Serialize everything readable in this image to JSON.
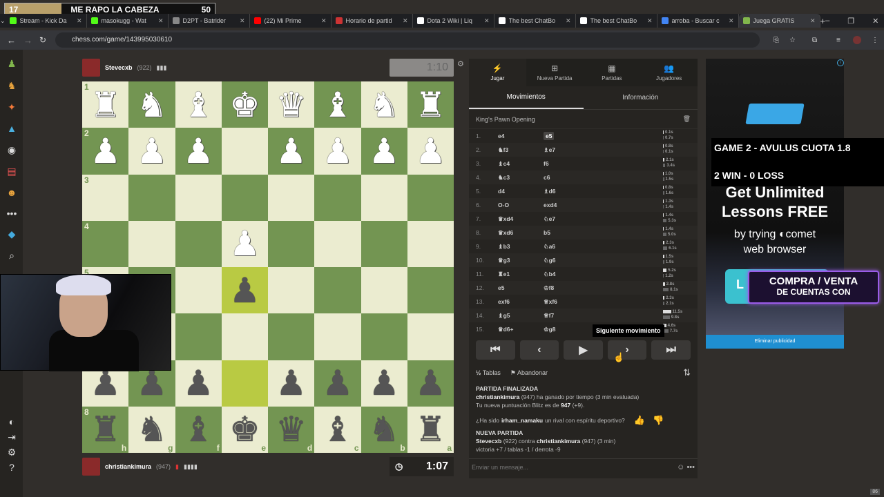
{
  "overlay": {
    "left": "17",
    "title": "ME RAPO LA CABEZA",
    "right": "50",
    "fill": 0.27
  },
  "tabs": [
    {
      "label": "Stream - Kick Da",
      "color": "#53fc18"
    },
    {
      "label": "masokugg - Wat",
      "color": "#53fc18"
    },
    {
      "label": "D2PT - Batrider",
      "color": "#888888"
    },
    {
      "label": "(22) Mi Prime",
      "color": "#ff0000"
    },
    {
      "label": "Horario de partid",
      "color": "#c33"
    },
    {
      "label": "Dota 2 Wiki | Liq",
      "color": "#ffffff"
    },
    {
      "label": "The best ChatBo",
      "color": "#ffffff"
    },
    {
      "label": "The best ChatBo",
      "color": "#ffffff"
    },
    {
      "label": "arroba - Buscar c",
      "color": "#4285f4"
    },
    {
      "label": "Juega GRATIS",
      "color": "#81b64c",
      "active": true
    }
  ],
  "address": {
    "url": "chess.com/game/143995030610"
  },
  "top_player": {
    "name": "Stevecxb",
    "rating": "(922)",
    "clock": "1:10"
  },
  "bottom_player": {
    "name": "christiankimura",
    "rating": "(947)",
    "clock": "1:07"
  },
  "board": {
    "rows": [
      "RNBKQBNR",
      "PPP.PPPP",
      "........",
      "...P....",
      "...p....",
      "........",
      "ppp.pppp",
      "rnbkqbnr"
    ],
    "rank_labels": [
      "1",
      "2",
      "3",
      "4",
      "5",
      "6",
      "7",
      "8"
    ],
    "file_labels": [
      "h",
      "g",
      "f",
      "e",
      "d",
      "c",
      "b",
      "a"
    ],
    "highlights": [
      "4-3",
      "6-3"
    ]
  },
  "panel": {
    "tabs": [
      {
        "label": "Jugar",
        "icon": "⚡"
      },
      {
        "label": "Nueva Partida",
        "icon": "⊞"
      },
      {
        "label": "Partidas",
        "icon": "▦"
      },
      {
        "label": "Jugadores",
        "icon": "👥"
      }
    ],
    "subtabs": [
      "Movimientos",
      "Información"
    ],
    "opening": "King's Pawn Opening",
    "moves": [
      {
        "n": "1.",
        "w": "e4",
        "b": "e5",
        "tw": "0.1s",
        "tb": "0.7s"
      },
      {
        "n": "2.",
        "w": "♞f3",
        "b": "♗e7",
        "tw": "0.8s",
        "tb": "0.1s"
      },
      {
        "n": "3.",
        "w": "♝c4",
        "b": "f6",
        "tw": "2.1s",
        "tb": "3.4s"
      },
      {
        "n": "4.",
        "w": "♞c3",
        "b": "c6",
        "tw": "1.0s",
        "tb": "1.5s"
      },
      {
        "n": "5.",
        "w": "d4",
        "b": "♗d6",
        "tw": "0.8s",
        "tb": "1.6s"
      },
      {
        "n": "6.",
        "w": "O-O",
        "b": "exd4",
        "tw": "1.3s",
        "tb": "1.4s"
      },
      {
        "n": "7.",
        "w": "♛xd4",
        "b": "♘e7",
        "tw": "1.4s",
        "tb": "5.3s"
      },
      {
        "n": "8.",
        "w": "♛xd6",
        "b": "b5",
        "tw": "1.4s",
        "tb": "5.0s"
      },
      {
        "n": "9.",
        "w": "♝b3",
        "b": "♘a6",
        "tw": "2.3s",
        "tb": "6.1s"
      },
      {
        "n": "10.",
        "w": "♛g3",
        "b": "♘g6",
        "tw": "1.5s",
        "tb": "1.9s"
      },
      {
        "n": "11.",
        "w": "♜e1",
        "b": "♘b4",
        "tw": "5.2s",
        "tb": "1.2s"
      },
      {
        "n": "12.",
        "w": "e5",
        "b": "♔f8",
        "tw": "2.8s",
        "tb": "8.1s"
      },
      {
        "n": "13.",
        "w": "exf6",
        "b": "♕xf6",
        "tw": "2.3s",
        "tb": "2.1s"
      },
      {
        "n": "14.",
        "w": "♝g5",
        "b": "♕f7",
        "tw": "11.5s",
        "tb": "9.8s"
      },
      {
        "n": "15.",
        "w": "♛d6+",
        "b": "♔g8",
        "tw": "4.6s",
        "tb": "7.7s"
      }
    ],
    "tooltip": "Siguiente movimiento",
    "draw_label": "Tablas",
    "draw_icon": "½",
    "resign_label": "Abandonar",
    "chat": {
      "finished_header": "PARTIDA FINALIZADA",
      "winner": "christiankimura",
      "winner_rest": "(947) ha ganado por tiempo (3 min evaluada)",
      "rating_pre": "Tu nueva puntuación Blitz es de",
      "rating_val": "947",
      "rating_delta": "(+9).",
      "sport_pre": "¿Ha sido",
      "sport_user": "irham_namaku",
      "sport_post": "un rival con espíritu deportivo?",
      "new_header": "NUEVA PARTIDA",
      "p1": "Stevecxb",
      "p1_rest": "(922) contra",
      "p2": "christiankimura",
      "p2_rest": "(947) (3 min)",
      "odds": "victoria +7 / tablas -1 / derrota -9"
    },
    "input_placeholder": "Enviar un mensaje..."
  },
  "ad": {
    "line1": "Get Unlimited",
    "line2": "Lessons FREE",
    "line3": "by trying ◐comet",
    "line4": "web browser",
    "button": "L",
    "remove": "Eliminar publicidad"
  },
  "stream_overlay": {
    "line1": "GAME 2 - AVULUS CUOTA 1.8",
    "line2": "2 WIN - 0 LOSS",
    "promo1": "COMPRA / VENTA",
    "promo2": "DE CUENTAS CON"
  },
  "corner_badge": "86"
}
